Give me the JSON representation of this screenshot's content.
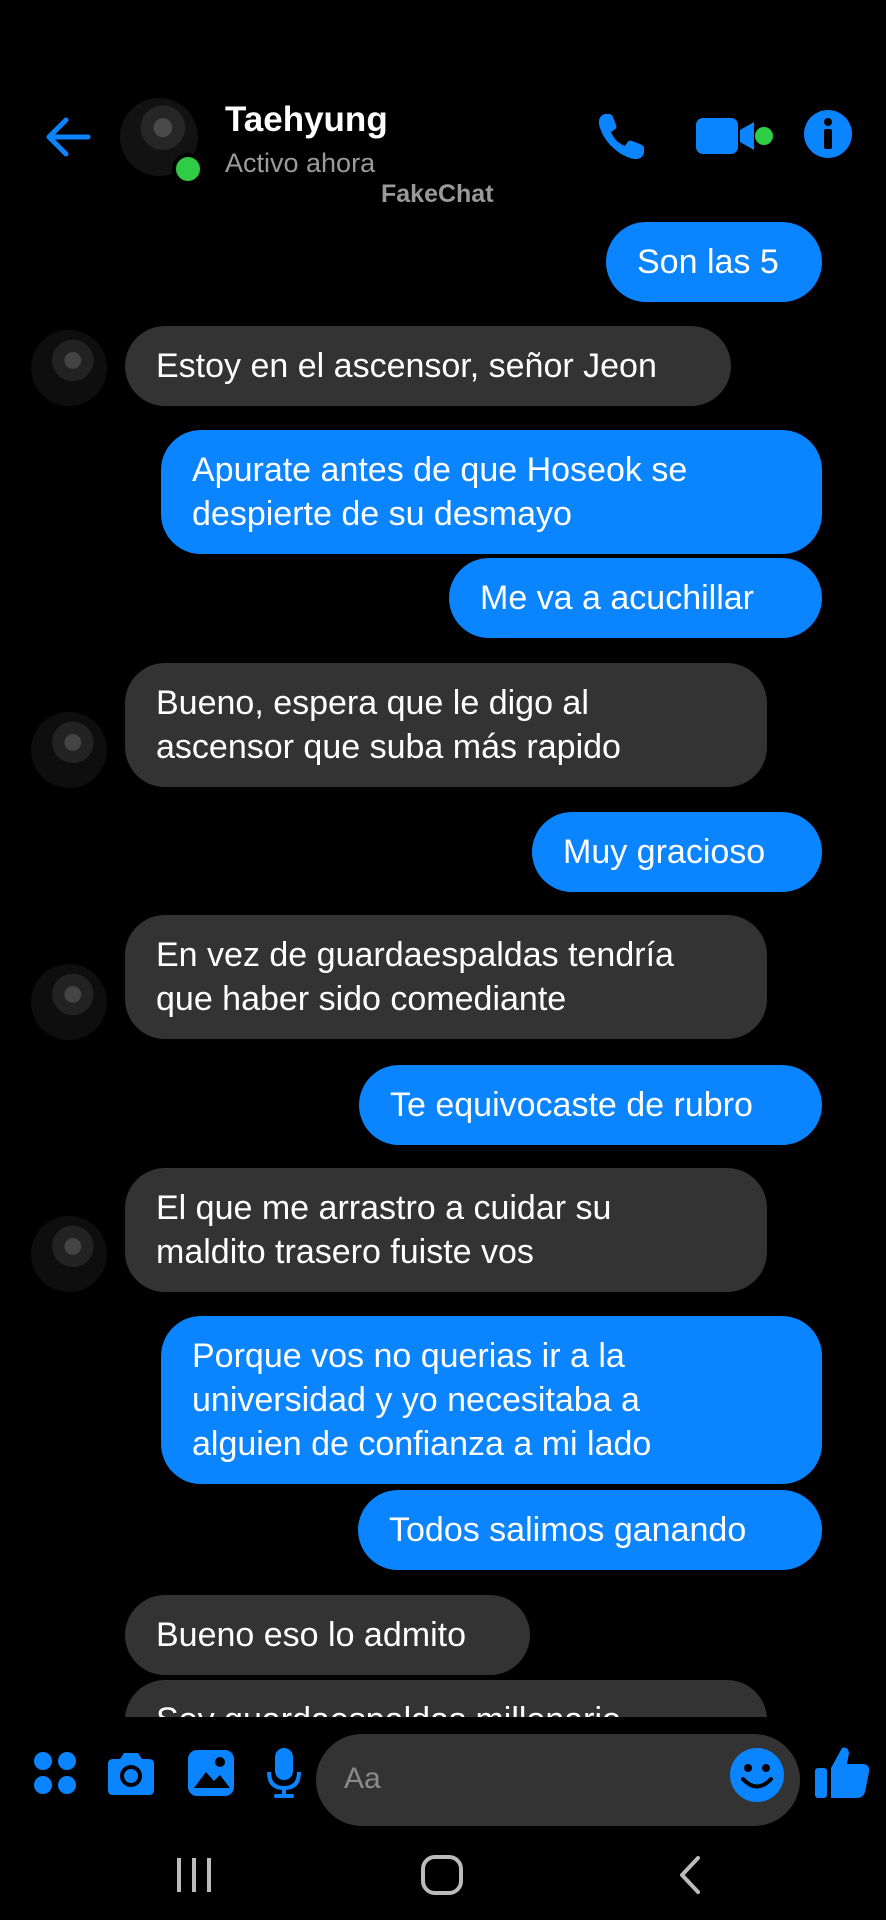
{
  "header": {
    "contact_name": "Taehyung",
    "status": "Activo ahora",
    "watermark": "FakeChat"
  },
  "messages": [
    {
      "dir": "out",
      "text": "Son las 5"
    },
    {
      "dir": "in",
      "text": "Estoy en el ascensor, señor Jeon"
    },
    {
      "dir": "out",
      "lines": [
        "Apurate antes de que Hoseok se",
        "despierte de su desmayo"
      ]
    },
    {
      "dir": "out",
      "text": "Me va a acuchillar"
    },
    {
      "dir": "in",
      "lines": [
        "Bueno, espera que le digo al",
        "ascensor que suba más rapido"
      ]
    },
    {
      "dir": "out",
      "text": "Muy gracioso"
    },
    {
      "dir": "in",
      "lines": [
        "En vez de guardaespaldas tendría",
        "que haber sido comediante"
      ]
    },
    {
      "dir": "out",
      "text": "Te equivocaste de rubro"
    },
    {
      "dir": "in",
      "lines": [
        "El que me arrastro a cuidar su",
        "maldito trasero fuiste vos"
      ]
    },
    {
      "dir": "out",
      "lines": [
        "Porque vos no querias ir a la",
        "universidad y yo necesitaba a",
        "alguien de confianza a mi lado"
      ]
    },
    {
      "dir": "out",
      "text": "Todos salimos ganando"
    },
    {
      "dir": "in",
      "text": "Bueno eso lo admito"
    },
    {
      "dir": "in",
      "text": "Soy guardaespaldas millonario"
    }
  ],
  "composer": {
    "placeholder": "Aa",
    "icons": [
      "apps-icon",
      "camera-icon",
      "gallery-icon",
      "microphone-icon",
      "emoji-icon",
      "thumbs-up-icon"
    ]
  },
  "colors": {
    "accent": "#0a84ff",
    "incoming_bubble": "#333333",
    "online": "#31cc46",
    "background": "#000000"
  }
}
